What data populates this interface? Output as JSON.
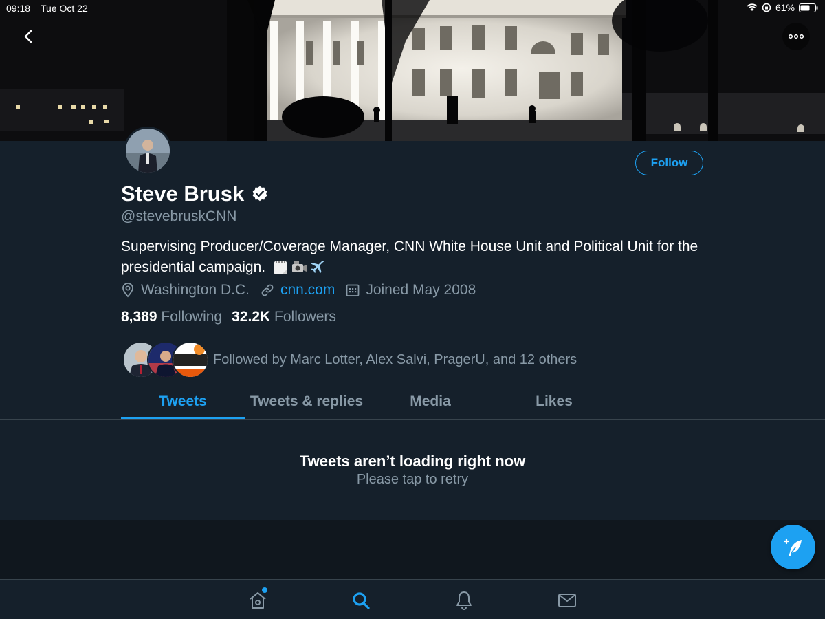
{
  "status_bar": {
    "time": "09:18",
    "date": "Tue Oct 22",
    "battery": "61%"
  },
  "profile": {
    "name": "Steve Brusk",
    "handle": "@stevebruskCNN",
    "bio": "Supervising Producer/Coverage Manager, CNN White House Unit and Political Unit for the presidential campaign.",
    "bio_emoji": [
      "spiral-notepad",
      "video-camera",
      "airplane"
    ],
    "location": "Washington D.C.",
    "website": "cnn.com",
    "joined": "Joined May 2008",
    "following_count": "8,389",
    "following_label": "Following",
    "followers_count": "32.2K",
    "followers_label": "Followers",
    "follow_button": "Follow",
    "verified": true,
    "followed_by": "Followed by Marc Lotter, Alex Salvi, PragerU, and 12 others"
  },
  "tabs": [
    {
      "label": "Tweets",
      "active": true
    },
    {
      "label": "Tweets & replies",
      "active": false
    },
    {
      "label": "Media",
      "active": false
    },
    {
      "label": "Likes",
      "active": false
    }
  ],
  "error": {
    "title": "Tweets aren’t loading right now",
    "retry": "Please tap to retry"
  },
  "bottom_nav": [
    {
      "icon": "home-icon",
      "active": false,
      "notification_dot": true
    },
    {
      "icon": "search-icon",
      "active": true
    },
    {
      "icon": "bell-icon",
      "active": false
    },
    {
      "icon": "mail-icon",
      "active": false
    }
  ],
  "colors": {
    "background": "#15202b",
    "accent": "#1da1f2",
    "secondary_text": "#8899a6",
    "divider": "#38444d"
  }
}
